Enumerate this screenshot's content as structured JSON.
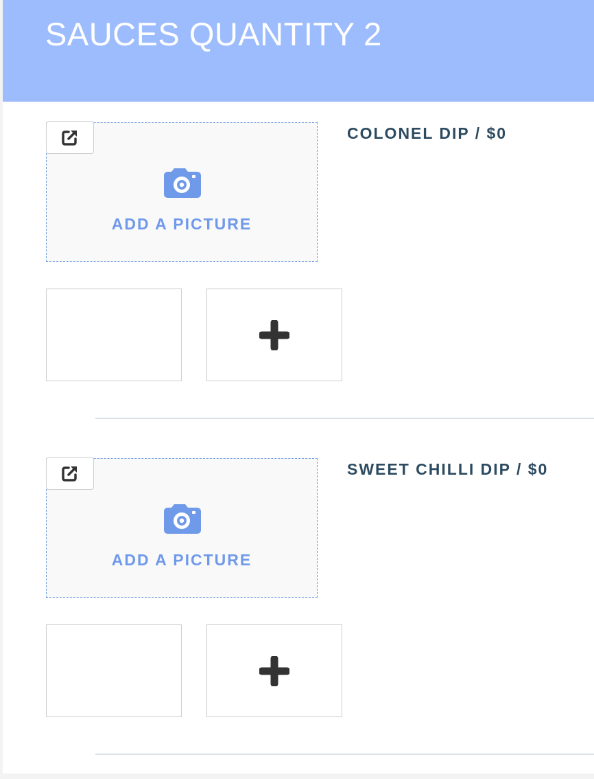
{
  "header": {
    "title": "SAUCES QUANTITY 2"
  },
  "items": [
    {
      "title": "COLONEL DIP / $0",
      "add_picture_label": "ADD A PICTURE"
    },
    {
      "title": "SWEET CHILLI DIP / $0",
      "add_picture_label": "ADD A PICTURE"
    }
  ],
  "icons": {
    "open": "external-link-icon",
    "camera": "camera-icon",
    "add": "plus-icon"
  },
  "colors": {
    "header_bg": "#9dbcfd",
    "accent": "#6f99e9",
    "title_text": "#2c4a60",
    "icon_dark": "#333333"
  }
}
